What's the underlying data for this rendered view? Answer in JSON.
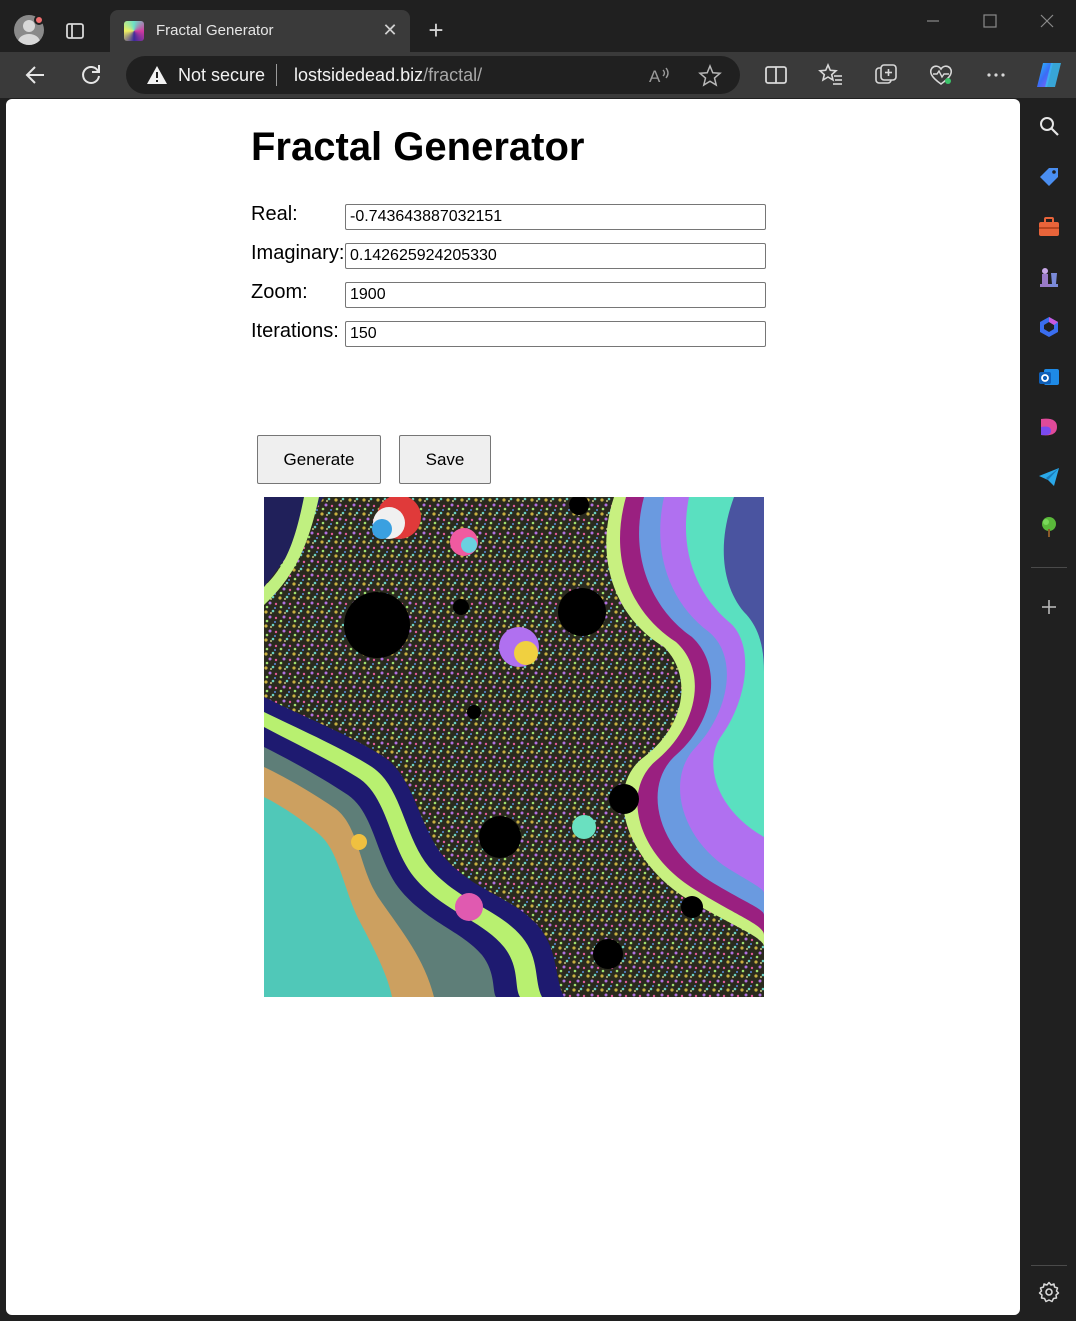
{
  "browser": {
    "tab_title": "Fractal Generator",
    "address": {
      "security_label": "Not secure",
      "host": "lostsidedead.biz",
      "path": "/fractal/"
    }
  },
  "page": {
    "title": "Fractal Generator",
    "fields": {
      "real": {
        "label": "Real:",
        "value": "-0.743643887032151"
      },
      "imaginary": {
        "label": "Imaginary:",
        "value": "0.142625924205330"
      },
      "zoom": {
        "label": "Zoom:",
        "value": "1900"
      },
      "iterations": {
        "label": "Iterations:",
        "value": "150"
      }
    },
    "buttons": {
      "generate": "Generate",
      "save": "Save"
    }
  }
}
